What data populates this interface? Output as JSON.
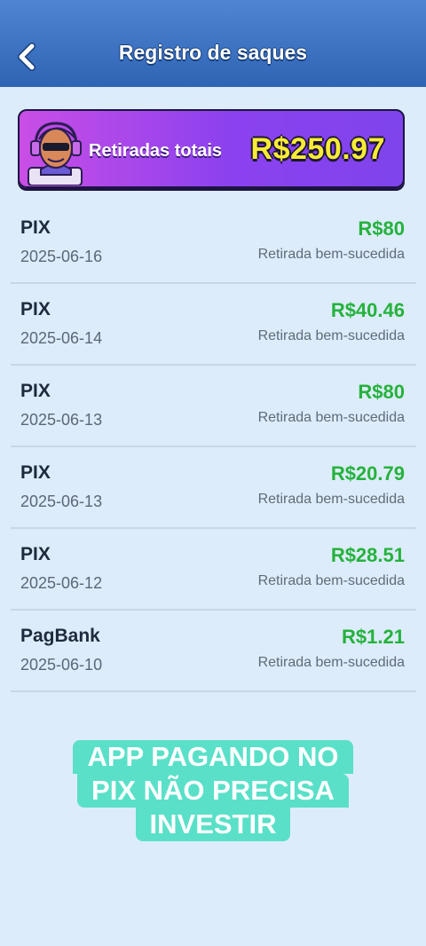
{
  "header": {
    "title": "Registro de saques",
    "back_icon": "chevron-left-icon"
  },
  "summary": {
    "label": "Retiradas totais",
    "value": "R$250.97",
    "avatar_icon": "gamer-avatar-headset-icon"
  },
  "withdrawals": [
    {
      "method": "PIX",
      "date": "2025-06-16",
      "amount": "R$80",
      "status": "Retirada bem-sucedida"
    },
    {
      "method": "PIX",
      "date": "2025-06-14",
      "amount": "R$40.46",
      "status": "Retirada bem-sucedida"
    },
    {
      "method": "PIX",
      "date": "2025-06-13",
      "amount": "R$80",
      "status": "Retirada bem-sucedida"
    },
    {
      "method": "PIX",
      "date": "2025-06-13",
      "amount": "R$20.79",
      "status": "Retirada bem-sucedida"
    },
    {
      "method": "PIX",
      "date": "2025-06-12",
      "amount": "R$28.51",
      "status": "Retirada bem-sucedida"
    },
    {
      "method": "PagBank",
      "date": "2025-06-10",
      "amount": "R$1.21",
      "status": "Retirada bem-sucedida"
    }
  ],
  "overlay_banner": {
    "lines": [
      "APP PAGANDO NO",
      "PIX NÃO PRECISA",
      "INVESTIR"
    ]
  },
  "colors": {
    "header": "#3a70c2",
    "background": "#dcecfb",
    "amount_green": "#25b23c",
    "total_yellow": "#f7ec34",
    "card_purple": "#8b41ef",
    "banner_teal": "#5ae0c8"
  }
}
